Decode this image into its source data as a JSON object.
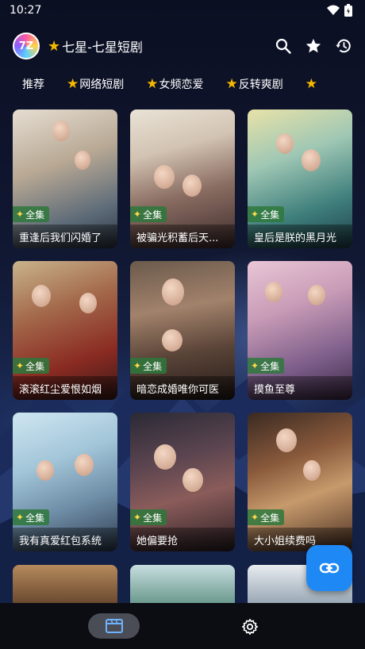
{
  "status_bar": {
    "time": "10:27"
  },
  "app_bar": {
    "logo_text": "7Z",
    "title": "七星-七星短剧"
  },
  "tabs": [
    {
      "label": "推荐",
      "starred": false
    },
    {
      "label": "网络短剧",
      "starred": true
    },
    {
      "label": "女频恋爱",
      "starred": true
    },
    {
      "label": "反转爽剧",
      "starred": true
    }
  ],
  "dramas": [
    {
      "title": "重逢后我们闪婚了",
      "badge": "全集"
    },
    {
      "title": "被骗光积蓄后天...",
      "badge": "全集"
    },
    {
      "title": "皇后是朕的黑月光",
      "badge": "全集"
    },
    {
      "title": "滚滚红尘爱恨如烟",
      "badge": "全集"
    },
    {
      "title": "暗恋成婚唯你可医",
      "badge": "全集"
    },
    {
      "title": "摸鱼至尊",
      "badge": "全集"
    },
    {
      "title": "我有真爱红包系统",
      "badge": "全集"
    },
    {
      "title": "她偏要抢",
      "badge": "全集"
    },
    {
      "title": "大小姐续费吗",
      "badge": "全集"
    }
  ],
  "colors": {
    "accent_star": "#f5b800",
    "fab": "#1e88f5",
    "badge_green": "#2e783c"
  },
  "icons": {
    "search": "search-icon",
    "favorite": "star-icon",
    "history": "history-icon",
    "fab": "link-icon",
    "nav_films": "film-icon",
    "nav_settings": "gear-icon"
  }
}
